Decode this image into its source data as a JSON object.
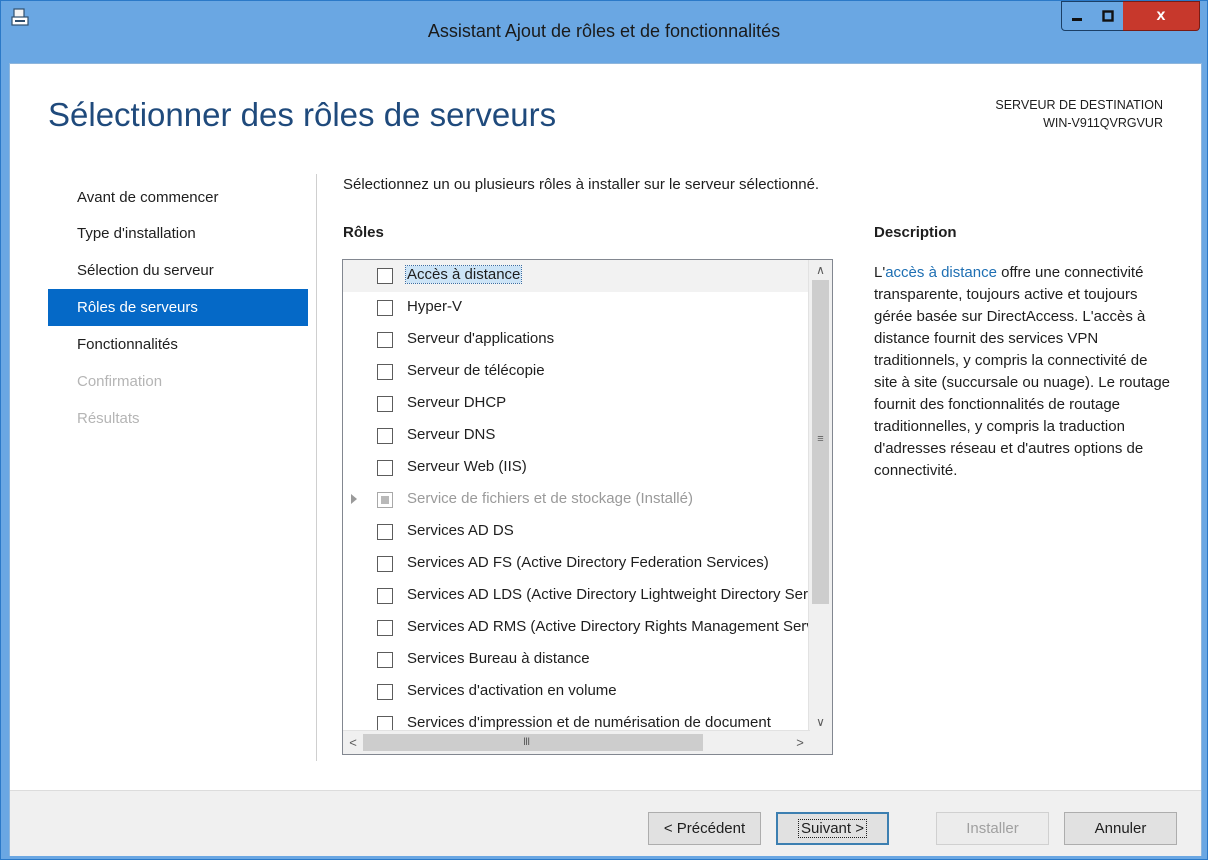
{
  "window": {
    "title": "Assistant Ajout de rôles et de fonctionnalités",
    "close_glyph": "x"
  },
  "page": {
    "title": "Sélectionner des rôles de serveurs",
    "destination_label": "SERVEUR DE DESTINATION",
    "destination_server": "WIN-V911QVRGVUR"
  },
  "nav": {
    "items": [
      {
        "label": "Avant de commencer",
        "state": "normal"
      },
      {
        "label": "Type d'installation",
        "state": "normal"
      },
      {
        "label": "Sélection du serveur",
        "state": "normal"
      },
      {
        "label": "Rôles de serveurs",
        "state": "active"
      },
      {
        "label": "Fonctionnalités",
        "state": "normal"
      },
      {
        "label": "Confirmation",
        "state": "disabled"
      },
      {
        "label": "Résultats",
        "state": "disabled"
      }
    ]
  },
  "content": {
    "intro": "Sélectionnez un ou plusieurs rôles à installer sur le serveur sélectionné.",
    "roles_heading": "Rôles",
    "description_heading": "Description",
    "description_link": "accès à distance",
    "description_prefix": "L'",
    "description_body": " offre une connectivité transparente, toujours active et toujours gérée basée sur DirectAccess. L'accès à distance fournit des services VPN traditionnels, y compris la connectivité de site à site (succursale ou nuage). Le routage fournit des fonctionnalités de routage traditionnelles, y compris la traduction d'adresses réseau et d'autres options de connectivité."
  },
  "roles": [
    {
      "label": "Accès à distance"
    },
    {
      "label": "Hyper-V"
    },
    {
      "label": "Serveur d'applications"
    },
    {
      "label": "Serveur de télécopie"
    },
    {
      "label": "Serveur DHCP"
    },
    {
      "label": "Serveur DNS"
    },
    {
      "label": "Serveur Web (IIS)"
    },
    {
      "label": "Service de fichiers et de stockage (Installé)"
    },
    {
      "label": "Services AD DS"
    },
    {
      "label": "Services AD FS (Active Directory Federation Services)"
    },
    {
      "label": "Services AD LDS (Active Directory Lightweight Directory Services)"
    },
    {
      "label": "Services AD RMS (Active Directory Rights Management Services)"
    },
    {
      "label": "Services Bureau à distance"
    },
    {
      "label": "Services d'activation en volume"
    },
    {
      "label": "Services d'impression et de numérisation de document"
    }
  ],
  "scrollbars": {
    "up": "∧",
    "down": "∨",
    "left": "<",
    "right": ">",
    "vgrip": "≡",
    "hgrip": "III"
  },
  "buttons": {
    "prev": "< Précédent",
    "next": "Suivant >",
    "install": "Installer",
    "cancel": "Annuler"
  }
}
